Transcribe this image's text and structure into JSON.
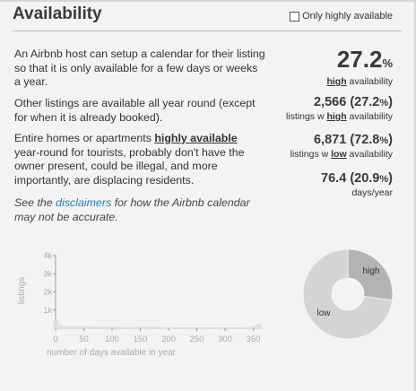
{
  "header": {
    "title": "Availability",
    "toggle_label": "Only highly available"
  },
  "paragraphs": {
    "p1": "An Airbnb host can setup a calendar for their listing so that it is only available for a few days or weeks a year.",
    "p2": "Other listings are available all year round (except for when it is already booked).",
    "p3_pre": "Entire homes or apartments ",
    "p3_hl": "highly available",
    "p3_post": " year-round for tourists, probably don't have the owner present, could be illegal, and more importantly, are displacing residents.",
    "p4_pre": "See the ",
    "p4_link": "disclaimers",
    "p4_post": " for how the Airbnb calendar may not be accurate."
  },
  "stats": {
    "high_pct": "27.2",
    "high_pct_unit": "%",
    "high_label_hl": "high",
    "high_label_rest": " availability",
    "high_count": "2,566",
    "high_count_pct": "(27.2",
    "high_count_close": ")",
    "high_count_pre": "listings w ",
    "high_count_hl": "high",
    "high_count_post": " availability",
    "low_count": "6,871",
    "low_count_pct": "(72.8",
    "low_count_close": ")",
    "low_count_pre": "listings w ",
    "low_count_hl": "low",
    "low_count_post": " availability",
    "days": "76.4",
    "days_pct": "(20.9",
    "days_close": ")",
    "days_label": "days/year"
  },
  "colors": {
    "link": "#2a7ab0",
    "high": "#b3b3b3",
    "low": "#d4d4d4",
    "axis": "#999999"
  },
  "chart_data": [
    {
      "type": "bar",
      "xlabel": "number of days available in year",
      "ylabel": "listings",
      "x_ticks": [
        "0",
        "50",
        "100",
        "150",
        "200",
        "250",
        "300",
        "350"
      ],
      "y_ticks": [
        "1k",
        "2k",
        "3k",
        "4k"
      ],
      "xlim": [
        0,
        365
      ],
      "ylim": [
        0,
        4000
      ],
      "x": [
        0,
        10,
        20,
        30,
        40,
        50,
        60,
        70,
        80,
        90,
        100,
        110,
        120,
        130,
        140,
        150,
        160,
        170,
        180,
        190,
        200,
        210,
        220,
        230,
        240,
        250,
        260,
        270,
        280,
        290,
        300,
        310,
        320,
        330,
        340,
        350,
        360
      ],
      "values": [
        450,
        130,
        90,
        80,
        70,
        65,
        60,
        55,
        55,
        50,
        50,
        45,
        45,
        45,
        40,
        40,
        40,
        38,
        38,
        36,
        35,
        35,
        34,
        33,
        33,
        32,
        32,
        31,
        30,
        30,
        30,
        31,
        33,
        36,
        45,
        70,
        220
      ]
    },
    {
      "type": "pie",
      "categories": [
        "high",
        "low"
      ],
      "values": [
        27.2,
        72.8
      ]
    }
  ]
}
